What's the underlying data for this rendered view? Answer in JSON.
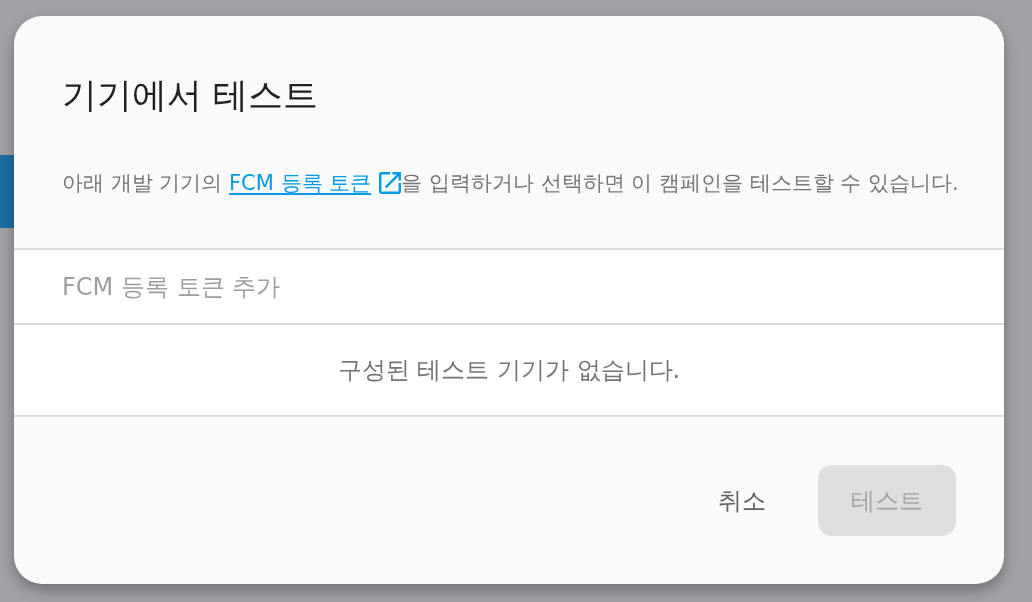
{
  "dialog": {
    "title": "기기에서 테스트",
    "description": {
      "before": "아래 개발 기기의 ",
      "link": "FCM 등록 토큰",
      "after": "을 입력하거나 선택하면 이 캠페인을 테스트할 수 있습니다."
    },
    "token_field": {
      "placeholder": "FCM 등록 토큰 추가"
    },
    "empty_message": "구성된 테스트 기기가 없습니다.",
    "buttons": [
      {
        "label": "취소",
        "kind": "text",
        "disabled": false
      },
      {
        "label": "테스트",
        "kind": "filled",
        "disabled": true
      }
    ]
  }
}
